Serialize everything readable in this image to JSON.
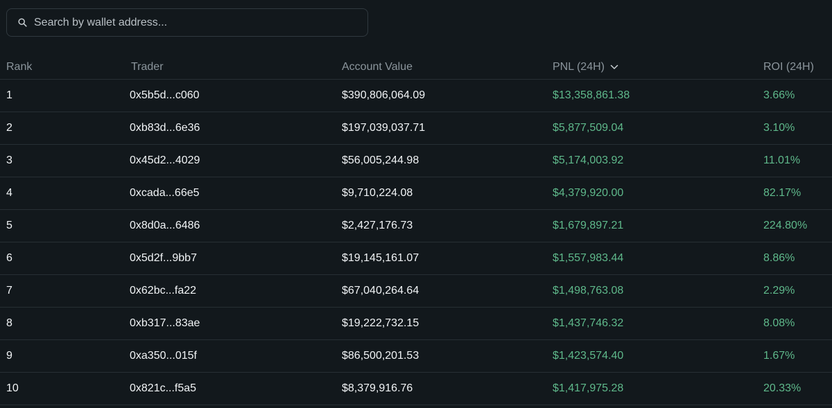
{
  "search": {
    "placeholder": "Search by wallet address..."
  },
  "table": {
    "headers": {
      "rank": "Rank",
      "trader": "Trader",
      "account_value": "Account Value",
      "pnl": "PNL (24H)",
      "roi": "ROI (24H)"
    },
    "sorted_by": "pnl",
    "sort_icon": "chevron-down-icon",
    "rows": [
      {
        "rank": "1",
        "trader": "0x5b5d...c060",
        "account_value": "$390,806,064.09",
        "pnl": "$13,358,861.38",
        "roi": "3.66%"
      },
      {
        "rank": "2",
        "trader": "0xb83d...6e36",
        "account_value": "$197,039,037.71",
        "pnl": "$5,877,509.04",
        "roi": "3.10%"
      },
      {
        "rank": "3",
        "trader": "0x45d2...4029",
        "account_value": "$56,005,244.98",
        "pnl": "$5,174,003.92",
        "roi": "11.01%"
      },
      {
        "rank": "4",
        "trader": "0xcada...66e5",
        "account_value": "$9,710,224.08",
        "pnl": "$4,379,920.00",
        "roi": "82.17%"
      },
      {
        "rank": "5",
        "trader": "0x8d0a...6486",
        "account_value": "$2,427,176.73",
        "pnl": "$1,679,897.21",
        "roi": "224.80%"
      },
      {
        "rank": "6",
        "trader": "0x5d2f...9bb7",
        "account_value": "$19,145,161.07",
        "pnl": "$1,557,983.44",
        "roi": "8.86%"
      },
      {
        "rank": "7",
        "trader": "0x62bc...fa22",
        "account_value": "$67,040,264.64",
        "pnl": "$1,498,763.08",
        "roi": "2.29%"
      },
      {
        "rank": "8",
        "trader": "0xb317...83ae",
        "account_value": "$19,222,732.15",
        "pnl": "$1,437,746.32",
        "roi": "8.08%"
      },
      {
        "rank": "9",
        "trader": "0xa350...015f",
        "account_value": "$86,500,201.53",
        "pnl": "$1,423,574.40",
        "roi": "1.67%"
      },
      {
        "rank": "10",
        "trader": "0x821c...f5a5",
        "account_value": "$8,379,916.76",
        "pnl": "$1,417,975.28",
        "roi": "20.33%"
      }
    ]
  },
  "colors": {
    "background": "#12181c",
    "positive": "#5fb98b",
    "header_text": "#8b959c",
    "row_divider": "#272f34"
  }
}
